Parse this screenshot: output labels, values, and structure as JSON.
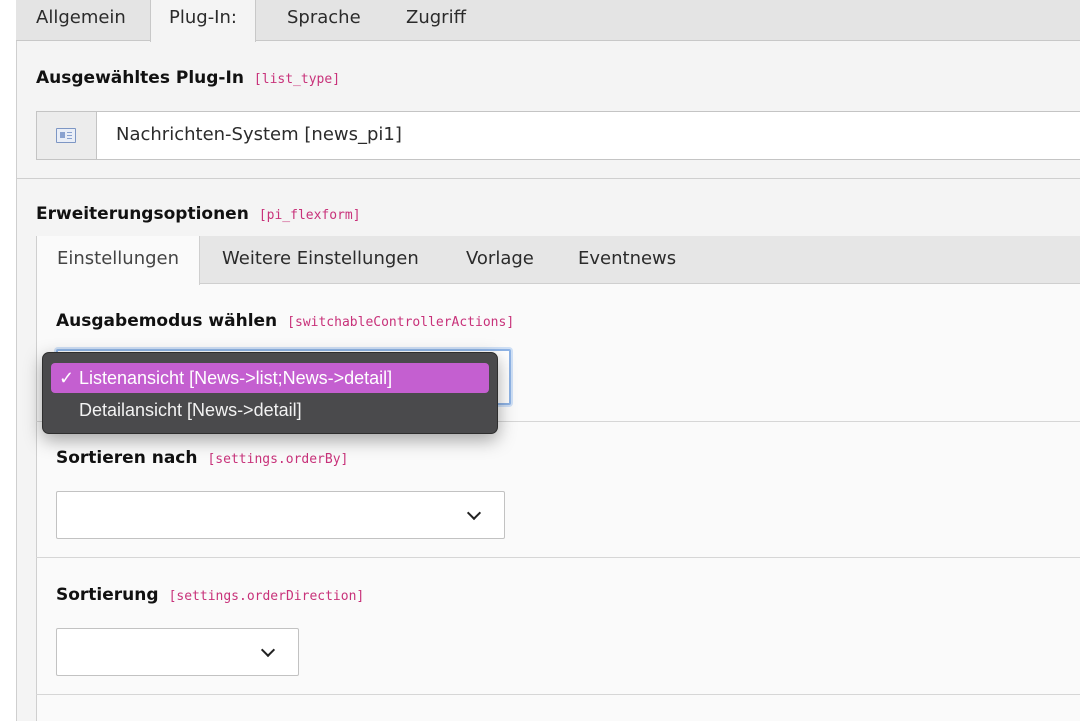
{
  "top_tabs": [
    "Allgemein",
    "Plug-In:",
    "Sprache",
    "Zugriff"
  ],
  "plugin_field": {
    "label": "Ausgewähltes Plug-In",
    "key": "[list_type]",
    "value": "Nachrichten-System [news_pi1]",
    "icon": "plugin-icon"
  },
  "flexform": {
    "label": "Erweiterungsoptionen",
    "key": "[pi_flexform]",
    "tabs": [
      "Einstellungen",
      "Weitere Einstellungen",
      "Vorlage",
      "Eventnews"
    ]
  },
  "output_mode": {
    "label": "Ausgabemodus wählen",
    "key": "[switchableControllerActions]",
    "options": [
      {
        "label": "Listenansicht [News->list;News->detail]",
        "selected": true
      },
      {
        "label": "Detailansicht [News->detail]",
        "selected": false
      }
    ],
    "check_mark": "✓"
  },
  "order_by": {
    "label": "Sortieren nach",
    "key": "[settings.orderBy]",
    "value": ""
  },
  "order_direction": {
    "label": "Sortierung",
    "key": "[settings.orderDirection]",
    "value": ""
  },
  "colors": {
    "field_key": "#c8327a",
    "selected_option": "#c45fd0",
    "popup_bg": "#4a4a4c"
  }
}
